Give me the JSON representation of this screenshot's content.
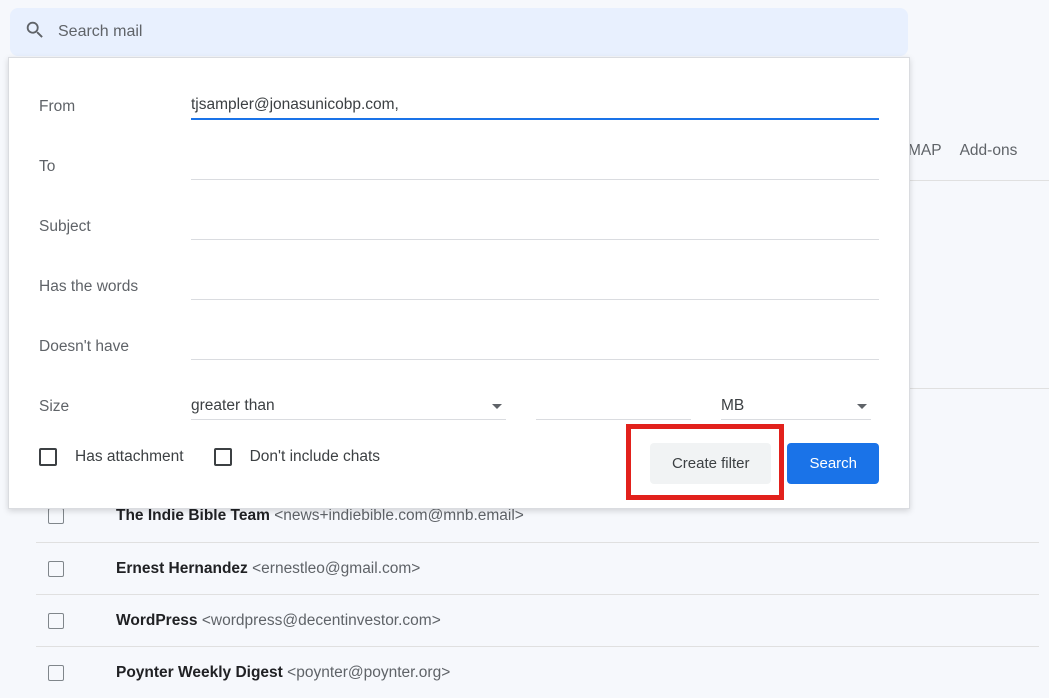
{
  "search": {
    "placeholder": "Search mail"
  },
  "filter": {
    "labels": {
      "from": "From",
      "to": "To",
      "subject": "Subject",
      "has_words": "Has the words",
      "doesnt_have": "Doesn't have",
      "size": "Size"
    },
    "values": {
      "from": "tjsampler@jonasunicobp.com,"
    },
    "size_op": "greater than",
    "size_unit": "MB",
    "checks": {
      "has_attachment": "Has attachment",
      "no_chats": "Don't include chats"
    },
    "buttons": {
      "create_filter": "Create filter",
      "search": "Search"
    }
  },
  "tabs": {
    "imap": "MAP",
    "addons": "Add-ons"
  },
  "emails": [
    {
      "name": "The Indie Bible Team",
      "address": "<news+indiebible.com@mnb.email>"
    },
    {
      "name": "Ernest Hernandez",
      "address": "<ernestleo@gmail.com>"
    },
    {
      "name": "WordPress",
      "address": "<wordpress@decentinvestor.com>"
    },
    {
      "name": "Poynter Weekly Digest",
      "address": "<poynter@poynter.org>"
    }
  ]
}
